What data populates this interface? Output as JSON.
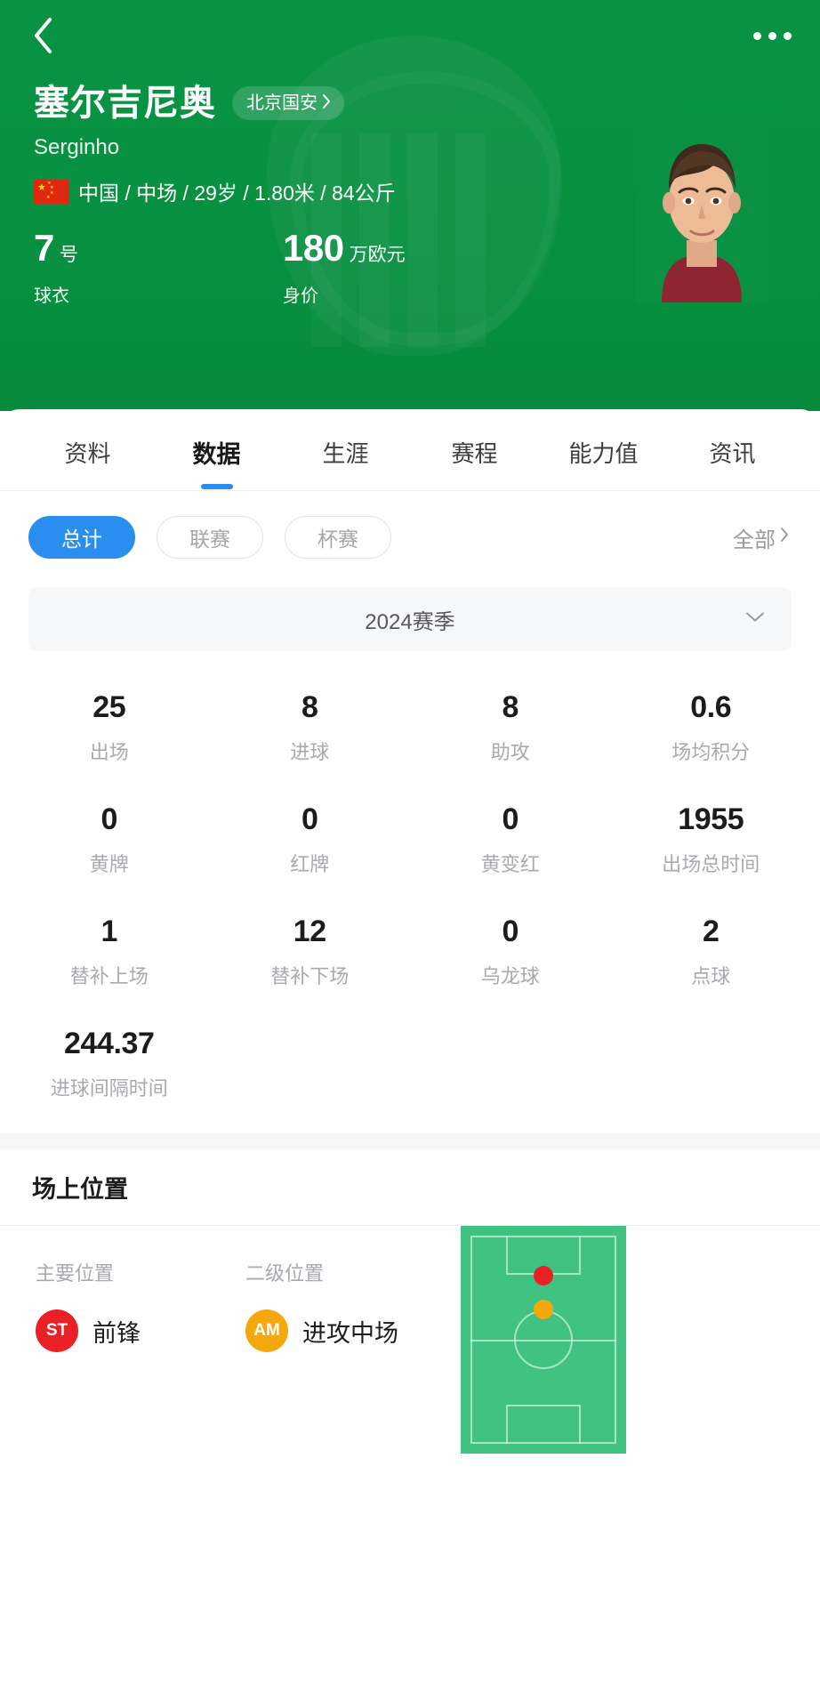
{
  "nav": {
    "back_icon": "chevron-left-icon",
    "more_icon": "more-horizontal-icon"
  },
  "header": {
    "player_name_cn": "塞尔吉尼奥",
    "player_name_en": "Serginho",
    "team_name": "北京国安",
    "team_chevron": "chevron-right-icon",
    "flag_icon": "china-flag-icon",
    "meta_text": "中国 / 中场 / 29岁 / 1.80米 / 84公斤",
    "jersey_number": "7",
    "jersey_unit": "号",
    "jersey_label": "球衣",
    "market_value": "180",
    "market_value_unit": "万欧元",
    "market_value_label": "身价",
    "accent_color": "#0a9144"
  },
  "tabs": [
    {
      "label": "资料",
      "active": false
    },
    {
      "label": "数据",
      "active": true
    },
    {
      "label": "生涯",
      "active": false
    },
    {
      "label": "赛程",
      "active": false
    },
    {
      "label": "能力值",
      "active": false
    },
    {
      "label": "资讯",
      "active": false
    }
  ],
  "tab_indicator_color": "#2a8ef0",
  "filters": {
    "chips": [
      {
        "label": "总计",
        "active": true
      },
      {
        "label": "联赛",
        "active": false
      },
      {
        "label": "杯赛",
        "active": false
      }
    ],
    "all_label": "全部",
    "all_chevron": "chevron-right-icon",
    "active_chip_color": "#2a8ef0"
  },
  "season": {
    "label": "2024赛季",
    "chevron": "chevron-down-icon"
  },
  "stats": [
    {
      "value": "25",
      "label": "出场"
    },
    {
      "value": "8",
      "label": "进球"
    },
    {
      "value": "8",
      "label": "助攻"
    },
    {
      "value": "0.6",
      "label": "场均积分"
    },
    {
      "value": "0",
      "label": "黄牌"
    },
    {
      "value": "0",
      "label": "红牌"
    },
    {
      "value": "0",
      "label": "黄变红"
    },
    {
      "value": "1955",
      "label": "出场总时间"
    },
    {
      "value": "1",
      "label": "替补上场"
    },
    {
      "value": "12",
      "label": "替补下场"
    },
    {
      "value": "0",
      "label": "乌龙球"
    },
    {
      "value": "2",
      "label": "点球"
    },
    {
      "value": "244.37",
      "label": "进球间隔时间"
    },
    {
      "value": "",
      "label": ""
    },
    {
      "value": "",
      "label": ""
    },
    {
      "value": "",
      "label": ""
    }
  ],
  "position_section": {
    "title": "场上位置",
    "primary": {
      "label": "主要位置",
      "badge": "ST",
      "badge_color": "#ea2027",
      "name": "前锋"
    },
    "secondary": {
      "label": "二级位置",
      "badge": "AM",
      "badge_color": "#f5a80c",
      "name": "进攻中场"
    },
    "pitch": {
      "field_color": "#3fc282",
      "primary_dot_color": "#ea2027",
      "secondary_dot_color": "#f5a80c"
    }
  }
}
